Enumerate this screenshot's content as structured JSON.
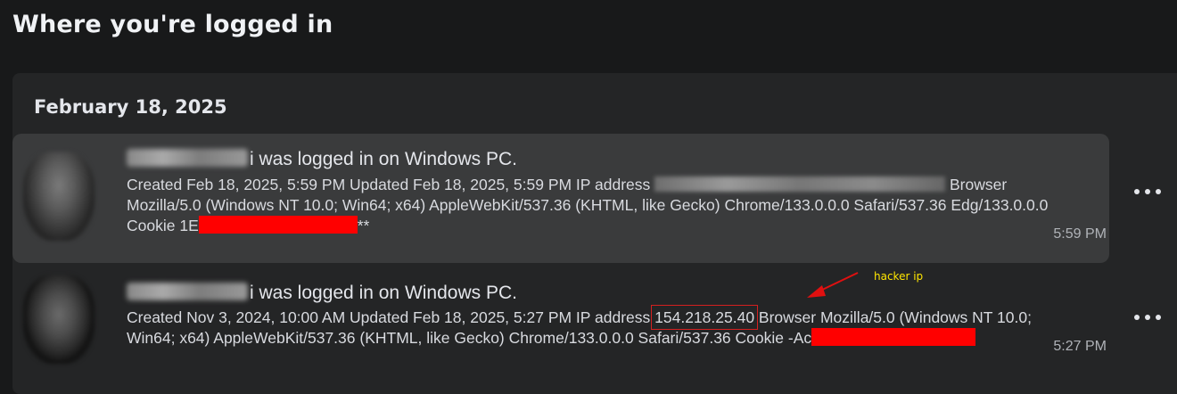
{
  "page": {
    "title": "Where you're logged in"
  },
  "date_group": {
    "label": "February 18, 2025"
  },
  "sessions": [
    {
      "headline": "i was logged in on Windows PC.",
      "details_1": "Created Feb 18, 2025, 5:59 PM Updated Feb 18, 2025, 5:59 PM IP address ",
      "details_2": " Browser Mozilla/5.0 (Windows NT 10.0; Win64; x64) AppleWebKit/537.36 (KHTML, like Gecko) Chrome/133.0.0.0 Safari/537.36 Edg/133.0.0.0 Cookie 1E",
      "details_3": "**",
      "time": "5:59 PM"
    },
    {
      "headline": "i was logged in on Windows PC.",
      "details_1": "Created Nov 3, 2024, 10:00 AM Updated Feb 18, 2025, 5:27 PM IP address ",
      "ip": "154.218.25.40",
      "details_2": " Browser Mozilla/5.0 (Windows NT 10.0; Win64; x64) AppleWebKit/537.36 (KHTML, like Gecko) Chrome/133.0.0.0 Safari/537.36 Cookie -Ac",
      "time": "5:27 PM"
    }
  ],
  "annotation": {
    "label": "hacker ip",
    "color": "#ffe600",
    "arrow_color": "#e01010"
  },
  "icons": {
    "more": "more-horizontal-icon"
  },
  "colors": {
    "background": "#18191a",
    "panel": "#242526",
    "highlight_row": "#3a3b3c",
    "redaction": "#ff0000"
  }
}
